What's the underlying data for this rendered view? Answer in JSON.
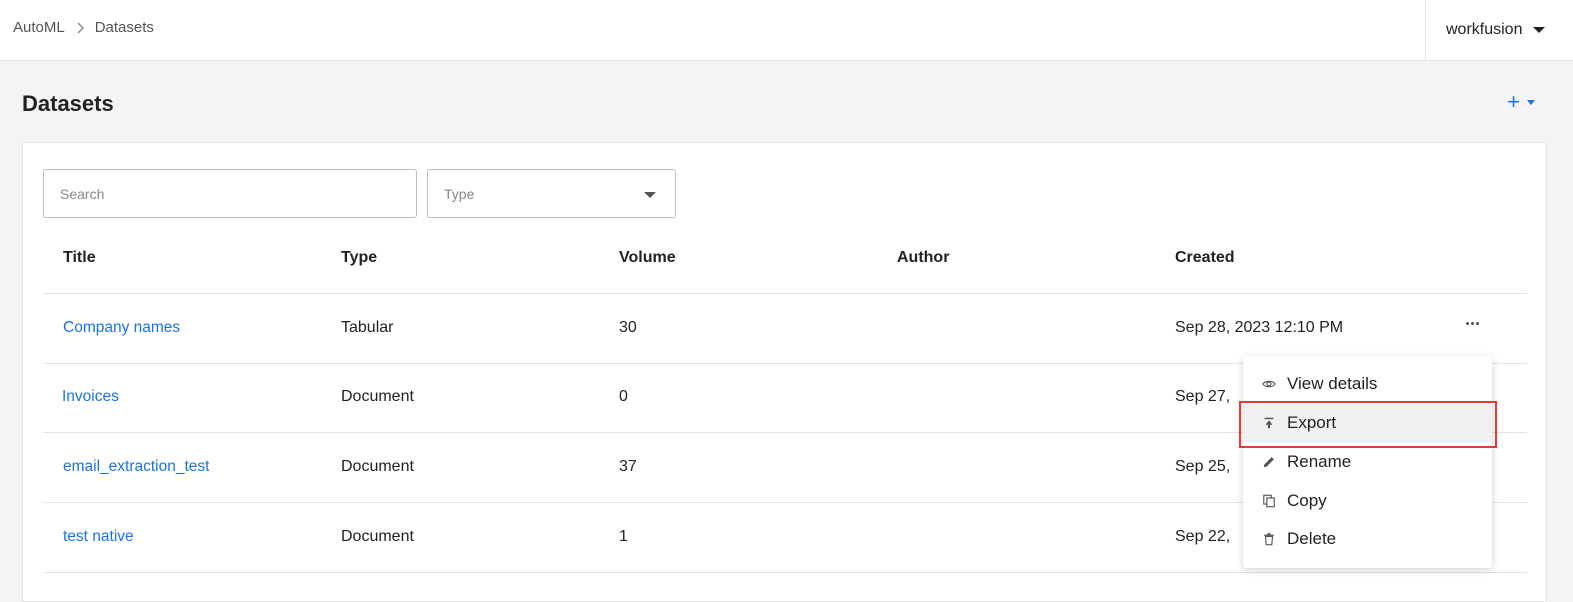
{
  "breadcrumb": {
    "root": "AutoML",
    "current": "Datasets"
  },
  "user": {
    "name": "workfusion"
  },
  "page": {
    "title": "Datasets",
    "add_label": "+"
  },
  "filters": {
    "search_placeholder": "Search",
    "type_placeholder": "Type"
  },
  "table": {
    "columns": [
      "Title",
      "Type",
      "Volume",
      "Author",
      "Created"
    ],
    "rows": [
      {
        "title": "Company names",
        "type": "Tabular",
        "volume": "30",
        "author": "",
        "created": "Sep 28, 2023 12:10 PM"
      },
      {
        "title": "Invoices",
        "type": "Document",
        "volume": "0",
        "author": "",
        "created": "Sep 27,"
      },
      {
        "title": "email_extraction_test",
        "type": "Document",
        "volume": "37",
        "author": "",
        "created": "Sep 25,"
      },
      {
        "title": "test native",
        "type": "Document",
        "volume": "1",
        "author": "",
        "created": "Sep 22,"
      }
    ]
  },
  "context_menu": {
    "items": [
      "View details",
      "Export",
      "Rename",
      "Copy",
      "Delete"
    ],
    "icons": [
      "eye-icon",
      "export-icon",
      "pencil-icon",
      "copy-icon",
      "trash-icon"
    ],
    "highlighted": "Export"
  },
  "colors": {
    "link": "#1a73e8",
    "highlight": "#e53935",
    "background": "#f4f4f4"
  }
}
